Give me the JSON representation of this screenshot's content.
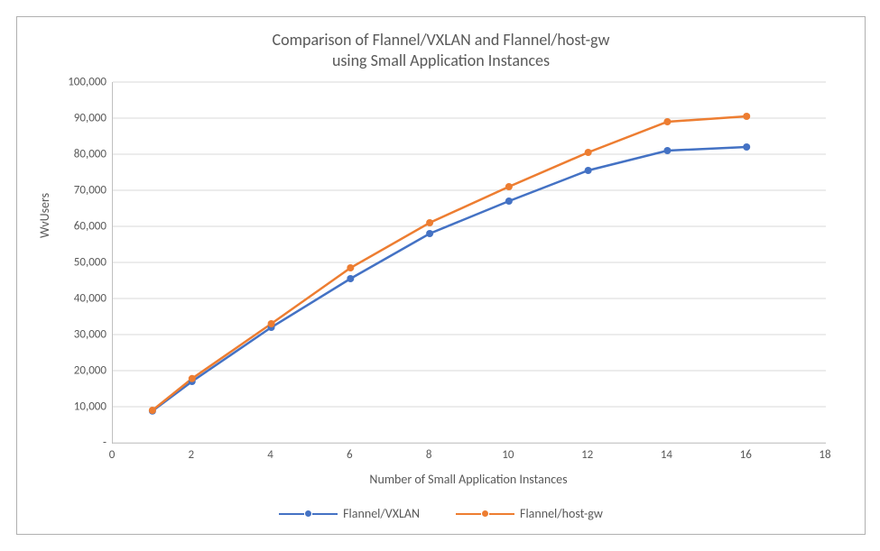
{
  "chart_data": {
    "type": "line",
    "title": "Comparison of Flannel/VXLAN and Flannel/host-gw\nusing Small Application Instances",
    "xlabel": "Number of Small Application Instances",
    "ylabel": "WvUsers",
    "xlim": [
      0,
      18
    ],
    "ylim": [
      0,
      100000
    ],
    "x_ticks": [
      0,
      2,
      4,
      6,
      8,
      10,
      12,
      14,
      16,
      18
    ],
    "y_ticks": [
      0,
      10000,
      20000,
      30000,
      40000,
      50000,
      60000,
      70000,
      80000,
      90000,
      100000
    ],
    "y_tick_labels": [
      "-",
      "10,000",
      "20,000",
      "30,000",
      "40,000",
      "50,000",
      "60,000",
      "70,000",
      "80,000",
      "90,000",
      "100,000"
    ],
    "x": [
      1,
      2,
      4,
      6,
      8,
      10,
      12,
      14,
      16
    ],
    "series": [
      {
        "name": "Flannel/VXLAN",
        "color": "#4472c4",
        "values": [
          8800,
          17000,
          32000,
          45500,
          58000,
          67000,
          75500,
          81000,
          82000
        ]
      },
      {
        "name": "Flannel/host-gw",
        "color": "#ed7d31",
        "values": [
          9000,
          17800,
          33000,
          48500,
          61000,
          71000,
          80500,
          89000,
          90500
        ]
      }
    ]
  }
}
